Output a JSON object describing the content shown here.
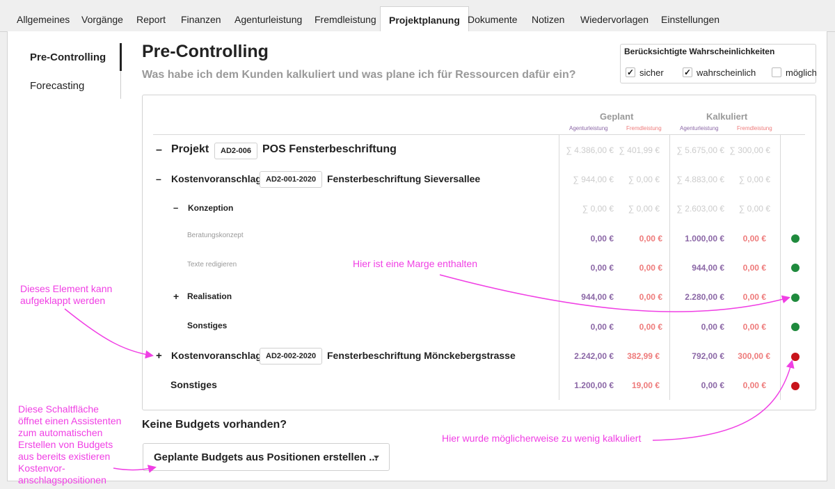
{
  "tabs": [
    "Allgemeines",
    "Vorgänge",
    "Report",
    "Finanzen",
    "Agenturleistung",
    "Fremdleistung",
    "Projektplanung",
    "Dokumente",
    "Notizen",
    "Wiedervorlagen",
    "Einstellungen"
  ],
  "active_tab": "Projektplanung",
  "sidebar": {
    "items": [
      "Pre-Controlling",
      "Forecasting"
    ],
    "active": "Pre-Controlling"
  },
  "page": {
    "title": "Pre-Controlling",
    "subtitle": "Was habe ich dem Kunden kalkuliert und was plane ich für Ressourcen dafür ein?"
  },
  "probabilities": {
    "title": "Berücksichtigte Wahrscheinlichkeiten",
    "options": [
      {
        "label": "sicher",
        "checked": true
      },
      {
        "label": "wahrscheinlich",
        "checked": true
      },
      {
        "label": "möglich",
        "checked": false
      }
    ]
  },
  "table": {
    "groups": [
      "Geplant",
      "Kalkuliert"
    ],
    "columns": [
      "Agenturleistung",
      "Fremdleistung",
      "Agenturleistung",
      "Fremdleistung"
    ],
    "rows": [
      {
        "toggle": "–",
        "prefix": "Projekt",
        "badge": "AD2-006",
        "name": "POS Fensterbeschriftung",
        "values": [
          "∑ 4.386,00 €",
          "∑ 401,99 €",
          "∑ 5.675,00 €",
          "∑ 300,00 €"
        ]
      },
      {
        "toggle": "–",
        "prefix": "Kostenvoranschlag",
        "badge": "AD2-001-2020",
        "name": "Fensterbeschriftung Sieversallee",
        "values": [
          "∑ 944,00 €",
          "∑ 0,00 €",
          "∑ 4.883,00 €",
          "∑ 0,00 €"
        ]
      },
      {
        "toggle": "–",
        "prefix": "Konzeption",
        "values": [
          "∑ 0,00 €",
          "∑ 0,00 €",
          "∑ 2.603,00 €",
          "∑ 0,00 €"
        ]
      },
      {
        "prefix": "Beratungskonzept",
        "values": [
          "0,00 €",
          "0,00 €",
          "1.000,00 €",
          "0,00 €"
        ],
        "status": "green"
      },
      {
        "prefix": "Texte redigieren",
        "values": [
          "0,00 €",
          "0,00 €",
          "944,00 €",
          "0,00 €"
        ],
        "status": "green"
      },
      {
        "toggle": "+",
        "prefix": "Realisation",
        "values": [
          "944,00 €",
          "0,00 €",
          "2.280,00 €",
          "0,00 €"
        ],
        "status": "green"
      },
      {
        "prefix": "Sonstiges",
        "values": [
          "0,00 €",
          "0,00 €",
          "0,00 €",
          "0,00 €"
        ],
        "status": "green"
      },
      {
        "toggle": "+",
        "prefix": "Kostenvoranschlag",
        "badge": "AD2-002-2020",
        "name": "Fensterbeschriftung Mönckebergstrasse",
        "values": [
          "2.242,00 €",
          "382,99 €",
          "792,00 €",
          "300,00 €"
        ],
        "status": "red"
      },
      {
        "prefix": "Sonstiges",
        "values": [
          "1.200,00 €",
          "19,00 €",
          "0,00 €",
          "0,00 €"
        ],
        "status": "red"
      }
    ]
  },
  "budgets": {
    "heading": "Keine Budgets vorhanden?",
    "button_label": "Geplante Budgets aus Positionen erstellen ..."
  },
  "annotations": {
    "expandable": "Dieses Element kann aufgeklappt werden",
    "margin": "Hier ist eine Marge enthalten",
    "assistant": "Diese Schaltfläche öffnet einen Assistenten zum automatischen Erstellen von Budgets aus bereits existieren Kostenvor-anschlagspositionen",
    "too_little": "Hier wurde möglicherweise zu wenig kalkuliert"
  },
  "colors": {
    "accent_purple": "#8b67a6",
    "accent_salmon": "#ee7b7b",
    "status_green": "#1f8a3d",
    "status_red": "#c8141b",
    "annotation": "#f03fe4"
  }
}
